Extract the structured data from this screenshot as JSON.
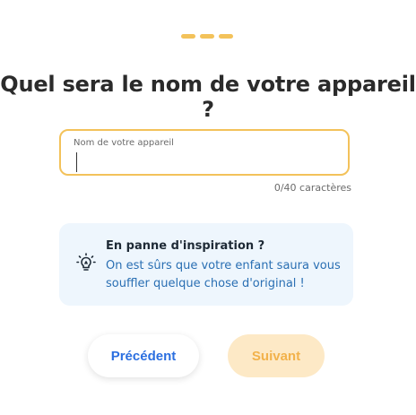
{
  "colors": {
    "accent": "#f3c25a",
    "primary_text": "#2b2b2b",
    "link_blue": "#2b6fe0",
    "tip_text_blue": "#2a6fb3",
    "tip_bg": "#eef6fd",
    "next_disabled_bg": "#fde9c6",
    "next_disabled_text": "#f2b24b"
  },
  "stepper": {
    "steps": [
      {
        "state": "active",
        "color": "#f3c25a"
      },
      {
        "state": "active",
        "color": "#f3c25a"
      },
      {
        "state": "active",
        "color": "#f3c25a"
      }
    ]
  },
  "heading": "Quel sera le nom de votre appareil ?",
  "name_field": {
    "label": "Nom de votre appareil",
    "value": "",
    "counter": "0/40 caractères"
  },
  "tip": {
    "icon": "lightbulb-icon",
    "title": "En panne d'inspiration ?",
    "text": "On est sûrs que votre enfant saura vous souffler quelque chose d'original !"
  },
  "buttons": {
    "previous": "Précédent",
    "next": "Suivant"
  }
}
